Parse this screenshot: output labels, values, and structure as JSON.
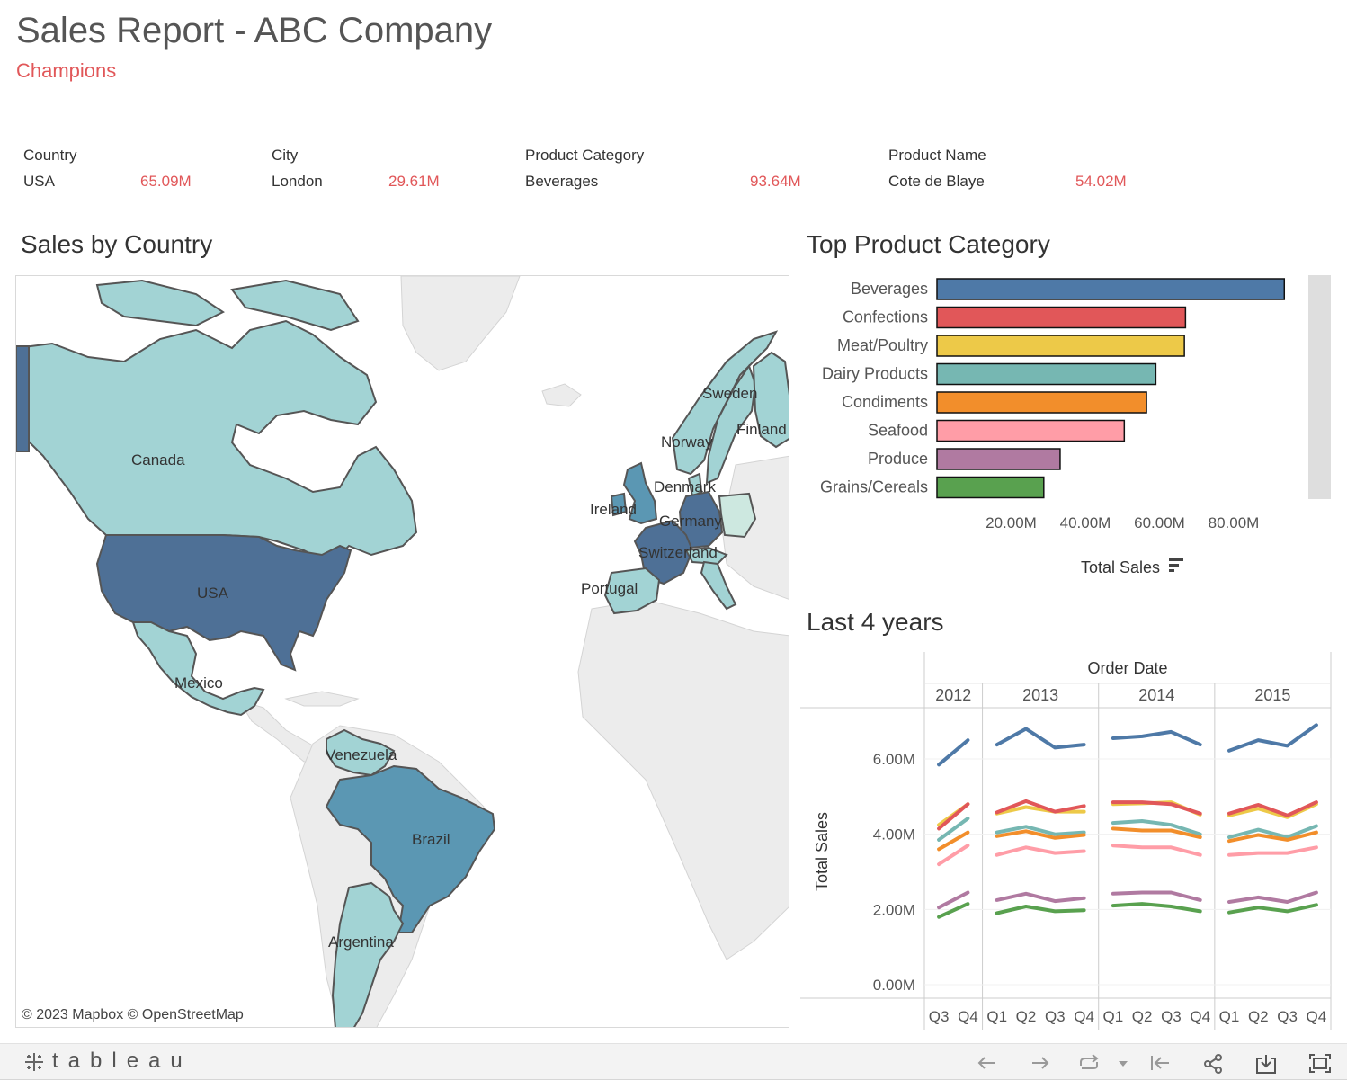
{
  "header": {
    "title": "Sales Report - ABC Company",
    "subtitle": "Champions",
    "accent_color": "#e15759"
  },
  "kpis": [
    {
      "label": "Country",
      "name": "USA",
      "value": "65.09M"
    },
    {
      "label": "City",
      "name": "London",
      "value": "29.61M"
    },
    {
      "label": "Product Category",
      "name": "Beverages",
      "value": "93.64M"
    },
    {
      "label": "Product Name",
      "name": "Cote de Blaye",
      "value": "54.02M"
    }
  ],
  "map": {
    "title": "Sales by Country",
    "attribution": "© 2023 Mapbox  © OpenStreetMap",
    "countries": [
      {
        "name": "Canada",
        "shade": "light"
      },
      {
        "name": "USA",
        "shade": "dark"
      },
      {
        "name": "Mexico",
        "shade": "light"
      },
      {
        "name": "Venezuela",
        "shade": "light"
      },
      {
        "name": "Brazil",
        "shade": "medium"
      },
      {
        "name": "Argentina",
        "shade": "light"
      },
      {
        "name": "Sweden",
        "shade": "light"
      },
      {
        "name": "Finland",
        "shade": "light"
      },
      {
        "name": "Norway",
        "shade": "light"
      },
      {
        "name": "Denmark",
        "shade": "light"
      },
      {
        "name": "Ireland",
        "shade": "medium"
      },
      {
        "name": "Germany",
        "shade": "dark"
      },
      {
        "name": "Switzerland",
        "shade": "light"
      },
      {
        "name": "Portugal",
        "shade": "light"
      }
    ],
    "colors": {
      "dark": "#4e7096",
      "medium": "#5b97b3",
      "light": "#a2d3d4",
      "lighter": "#cde8e0"
    }
  },
  "chart_data": [
    {
      "type": "bar",
      "title": "Top Product Category",
      "categories": [
        "Beverages",
        "Confections",
        "Meat/Poultry",
        "Dairy Products",
        "Condiments",
        "Seafood",
        "Produce",
        "Grains/Cereals"
      ],
      "values": [
        93.64,
        67.0,
        66.7,
        59.0,
        56.5,
        50.5,
        33.2,
        28.8
      ],
      "colors": [
        "#4e79a7",
        "#e15759",
        "#edc948",
        "#76b7b2",
        "#f28e2b",
        "#ff9da7",
        "#b07aa1",
        "#59a14f"
      ],
      "xlabel": "Total Sales",
      "xticks": [
        "20.00M",
        "40.00M",
        "60.00M",
        "80.00M"
      ],
      "xlim": [
        0,
        96
      ],
      "unit": "M"
    },
    {
      "type": "line",
      "title": "Last 4 years",
      "column_header": "Order Date",
      "ylabel": "Total Sales",
      "yticks": [
        "0.00M",
        "2.00M",
        "4.00M",
        "6.00M"
      ],
      "ylim": [
        0,
        7.0
      ],
      "years": [
        "2012",
        "2013",
        "2014",
        "2015"
      ],
      "quarters": [
        [
          "Q3",
          "Q4"
        ],
        [
          "Q1",
          "Q2",
          "Q3",
          "Q4"
        ],
        [
          "Q1",
          "Q2",
          "Q3",
          "Q4"
        ],
        [
          "Q1",
          "Q2",
          "Q3",
          "Q4"
        ]
      ],
      "series": [
        {
          "color": "#4e79a7",
          "values": [
            5.85,
            6.5,
            6.38,
            6.8,
            6.3,
            6.38,
            6.55,
            6.6,
            6.72,
            6.38,
            6.22,
            6.5,
            6.35,
            6.9
          ]
        },
        {
          "color": "#edc948",
          "values": [
            4.25,
            4.8,
            4.55,
            4.72,
            4.6,
            4.6,
            4.8,
            4.82,
            4.85,
            4.52,
            4.5,
            4.68,
            4.45,
            4.8
          ]
        },
        {
          "color": "#e15759",
          "values": [
            4.15,
            4.8,
            4.58,
            4.88,
            4.6,
            4.75,
            4.85,
            4.85,
            4.8,
            4.55,
            4.55,
            4.78,
            4.5,
            4.85
          ]
        },
        {
          "color": "#76b7b2",
          "values": [
            3.85,
            4.42,
            4.05,
            4.2,
            4.0,
            4.05,
            4.3,
            4.35,
            4.25,
            4.0,
            3.92,
            4.12,
            3.92,
            4.22
          ]
        },
        {
          "color": "#f28e2b",
          "values": [
            3.6,
            4.05,
            3.95,
            4.08,
            3.9,
            3.98,
            4.15,
            4.1,
            4.1,
            3.92,
            3.82,
            3.98,
            3.85,
            4.05
          ]
        },
        {
          "color": "#ff9da7",
          "values": [
            3.2,
            3.7,
            3.45,
            3.65,
            3.5,
            3.55,
            3.7,
            3.65,
            3.65,
            3.45,
            3.45,
            3.5,
            3.5,
            3.65
          ]
        },
        {
          "color": "#b07aa1",
          "values": [
            2.05,
            2.45,
            2.25,
            2.42,
            2.22,
            2.3,
            2.42,
            2.45,
            2.45,
            2.25,
            2.2,
            2.32,
            2.2,
            2.45
          ]
        },
        {
          "color": "#59a14f",
          "values": [
            1.8,
            2.15,
            1.9,
            2.08,
            1.95,
            1.98,
            2.1,
            2.15,
            2.08,
            1.95,
            1.92,
            2.05,
            1.95,
            2.12
          ]
        }
      ]
    }
  ],
  "footer": {
    "logo_text": "tableau",
    "tools": [
      "undo-icon",
      "redo-icon",
      "revert-icon",
      "dropdown-icon",
      "reset-icon",
      "share-icon",
      "download-icon",
      "fullscreen-icon"
    ]
  }
}
